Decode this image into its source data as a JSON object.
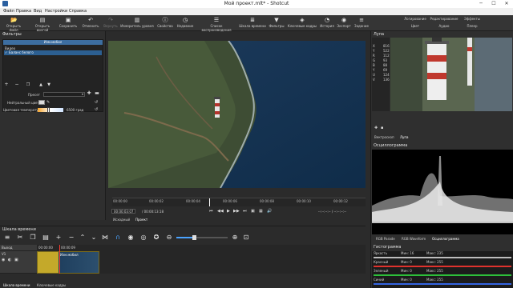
{
  "window": {
    "title": "Мой проект.mlt* - Shotcut",
    "minimize": "─",
    "maximize": "☐",
    "close": "✕"
  },
  "menubar": {
    "items": [
      "Файл",
      "Правка",
      "Вид",
      "Настройки",
      "Справка"
    ]
  },
  "toolbar": {
    "buttons": [
      {
        "label": "Открыть файл",
        "icon": "open-file-icon"
      },
      {
        "label": "Открыть другой",
        "icon": "open-other-icon"
      },
      {
        "label": "Сохранить",
        "icon": "save-icon"
      },
      {
        "label": "Отменить",
        "icon": "undo-icon"
      },
      {
        "label": "Вернуть",
        "icon": "redo-icon"
      },
      {
        "label": "Измеритель уровня",
        "icon": "level-meter-icon"
      },
      {
        "label": "Свойства",
        "icon": "properties-icon"
      },
      {
        "label": "Недавние",
        "icon": "recent-icon"
      },
      {
        "label": "Список воспроизведения",
        "icon": "playlist-icon"
      },
      {
        "label": "Шкала времени",
        "icon": "timeline-icon"
      },
      {
        "label": "Фильтры",
        "icon": "filters-icon"
      },
      {
        "label": "Ключевые кадры",
        "icon": "keyframes-icon"
      },
      {
        "label": "История",
        "icon": "history-icon"
      },
      {
        "label": "Экспорт",
        "icon": "export-icon"
      },
      {
        "label": "Задание",
        "icon": "jobs-icon"
      }
    ],
    "layouts": {
      "row1": [
        "Логирование",
        "Редактирование",
        "Эффекты"
      ],
      "row2": [
        "Цвет",
        "Аудио",
        "Плеер"
      ]
    }
  },
  "filters": {
    "title": "Фильтры",
    "header": "Изм.мобил",
    "section": "Видео",
    "selected_filter": "Баланс белого",
    "preset_label": "Пресет",
    "neutral_label": "Нейтральный цвет",
    "temperature_label": "Цветовая температура",
    "temperature_value": "6500",
    "temperature_unit": "град"
  },
  "viewer": {
    "ruler_ticks": [
      "00:00:00",
      "00:00:02",
      "00:00:04",
      "00:00:06",
      "00:00:08",
      "00:00:10",
      "00:00:12"
    ],
    "current_tc": "00:00:03:07",
    "total_tc": "/ 00:00:13:18",
    "in_out": "--:--:--:-- / --:--:--:--",
    "tabs": [
      "Исходный",
      "Проект"
    ]
  },
  "zoom_panel": {
    "title": "Лупа",
    "readout": [
      {
        "k": "X",
        "v": "816"
      },
      {
        "k": "Y",
        "v": "522"
      },
      {
        "k": "R",
        "v": "112"
      },
      {
        "k": "G",
        "v": "93"
      },
      {
        "k": "B",
        "v": "88"
      },
      {
        "k": "Y",
        "v": "69"
      },
      {
        "k": "U",
        "v": "124"
      },
      {
        "k": "V",
        "v": "136"
      }
    ],
    "tabs": [
      "Вектроскоп",
      "Лупа"
    ]
  },
  "oscilloscope": {
    "title": "Осциллограмма",
    "tabs": [
      "RGB Parade",
      "RGB Waveform",
      "Осциллограмма"
    ]
  },
  "histogram": {
    "title": "Гистограмма",
    "rows": [
      {
        "name": "Яркость",
        "min": "Мин: 16",
        "max": "Макс: 235",
        "color": "#bdbdbd"
      },
      {
        "name": "Красный",
        "min": "Мин: 0",
        "max": "Макс: 255",
        "color": "#e0322d"
      },
      {
        "name": "Зеленый",
        "min": "Мин: 0",
        "max": "Макс: 255",
        "color": "#2dbf3a"
      },
      {
        "name": "Синий",
        "min": "Мин: 0",
        "max": "Макс: 255",
        "color": "#3464e0"
      }
    ]
  },
  "timeline": {
    "title": "Шкала времени",
    "output_label": "Выход",
    "track_label": "V1",
    "tc_start": "00:00:00",
    "tc_mid": "00:00:09",
    "clip_label": "Изм.мобил",
    "bottom_tabs": [
      "Шкала времени",
      "Ключевые кадры"
    ]
  },
  "colors": {
    "accent": "#3d6ea0",
    "selection": "#2c5f91",
    "clip": "#c4a92a",
    "playhead": "#ff3b30"
  }
}
